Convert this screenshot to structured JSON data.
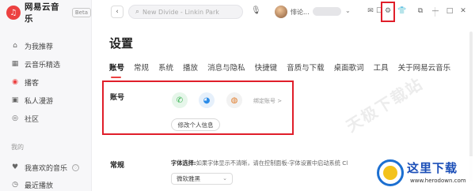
{
  "app": {
    "name": "网易云音乐",
    "badge": "Beta",
    "logo_glyph": "♫"
  },
  "sidebar": {
    "items": [
      {
        "label": "为我推荐",
        "icon": "home-icon",
        "glyph": "⌂"
      },
      {
        "label": "云音乐精选",
        "icon": "grid-icon",
        "glyph": "▦"
      },
      {
        "label": "播客",
        "icon": "podcast-icon",
        "glyph": "◉"
      },
      {
        "label": "私人漫游",
        "icon": "radio-icon",
        "glyph": "▣"
      },
      {
        "label": "社区",
        "icon": "community-icon",
        "glyph": "◎"
      }
    ],
    "section_mine": "我的",
    "mine_items": [
      {
        "label": "我喜欢的音乐",
        "icon": "heart-icon",
        "glyph": "♥"
      },
      {
        "label": "最近播放",
        "icon": "clock-icon",
        "glyph": "◷"
      }
    ]
  },
  "topbar": {
    "back_glyph": "‹",
    "search_placeholder": "New Divide - Linkin Park",
    "search_glyph": "⌕",
    "mic_glyph": "🎙",
    "username": "悱论...",
    "chev_glyph": "⌄",
    "icons": [
      {
        "name": "mail-icon",
        "glyph": "✉"
      },
      {
        "name": "messages-icon",
        "glyph": "☐"
      },
      {
        "name": "settings-icon",
        "glyph": "⚙"
      },
      {
        "name": "skin-icon",
        "glyph": "👕"
      },
      {
        "name": "mini-mode-icon",
        "glyph": "⧉"
      },
      {
        "name": "minimize-icon",
        "glyph": "—"
      },
      {
        "name": "maximize-icon",
        "glyph": "□"
      },
      {
        "name": "close-icon",
        "glyph": "✕"
      }
    ]
  },
  "settings": {
    "title": "设置",
    "tabs": [
      {
        "label": "账号",
        "active": true
      },
      {
        "label": "常规",
        "active": false
      },
      {
        "label": "系统",
        "active": false
      },
      {
        "label": "播放",
        "active": false
      },
      {
        "label": "消息与隐私",
        "active": false
      },
      {
        "label": "快捷键",
        "active": false
      },
      {
        "label": "音质与下载",
        "active": false
      },
      {
        "label": "桌面歌词",
        "active": false
      },
      {
        "label": "工具",
        "active": false
      },
      {
        "label": "关于网易云音乐",
        "active": false
      }
    ],
    "account": {
      "label": "账号",
      "bind_link": "绑定账号 >",
      "edit_button": "修改个人信息",
      "social": [
        {
          "name": "wechat-icon",
          "glyph": "✆"
        },
        {
          "name": "qq-icon",
          "glyph": "◕"
        },
        {
          "name": "weibo-icon",
          "glyph": "◍"
        }
      ]
    },
    "general": {
      "label": "常规",
      "font_label": "字体选择:",
      "font_hint": "如果字体显示不清晰，请在控制面板-字体设置中启动系统 Cl",
      "font_value": "微软雅黑",
      "arrow_glyph": "⌄"
    }
  },
  "watermarks": {
    "diagonal": "天极下载站",
    "brand": "这里下载",
    "url": "www.herodown.com"
  }
}
